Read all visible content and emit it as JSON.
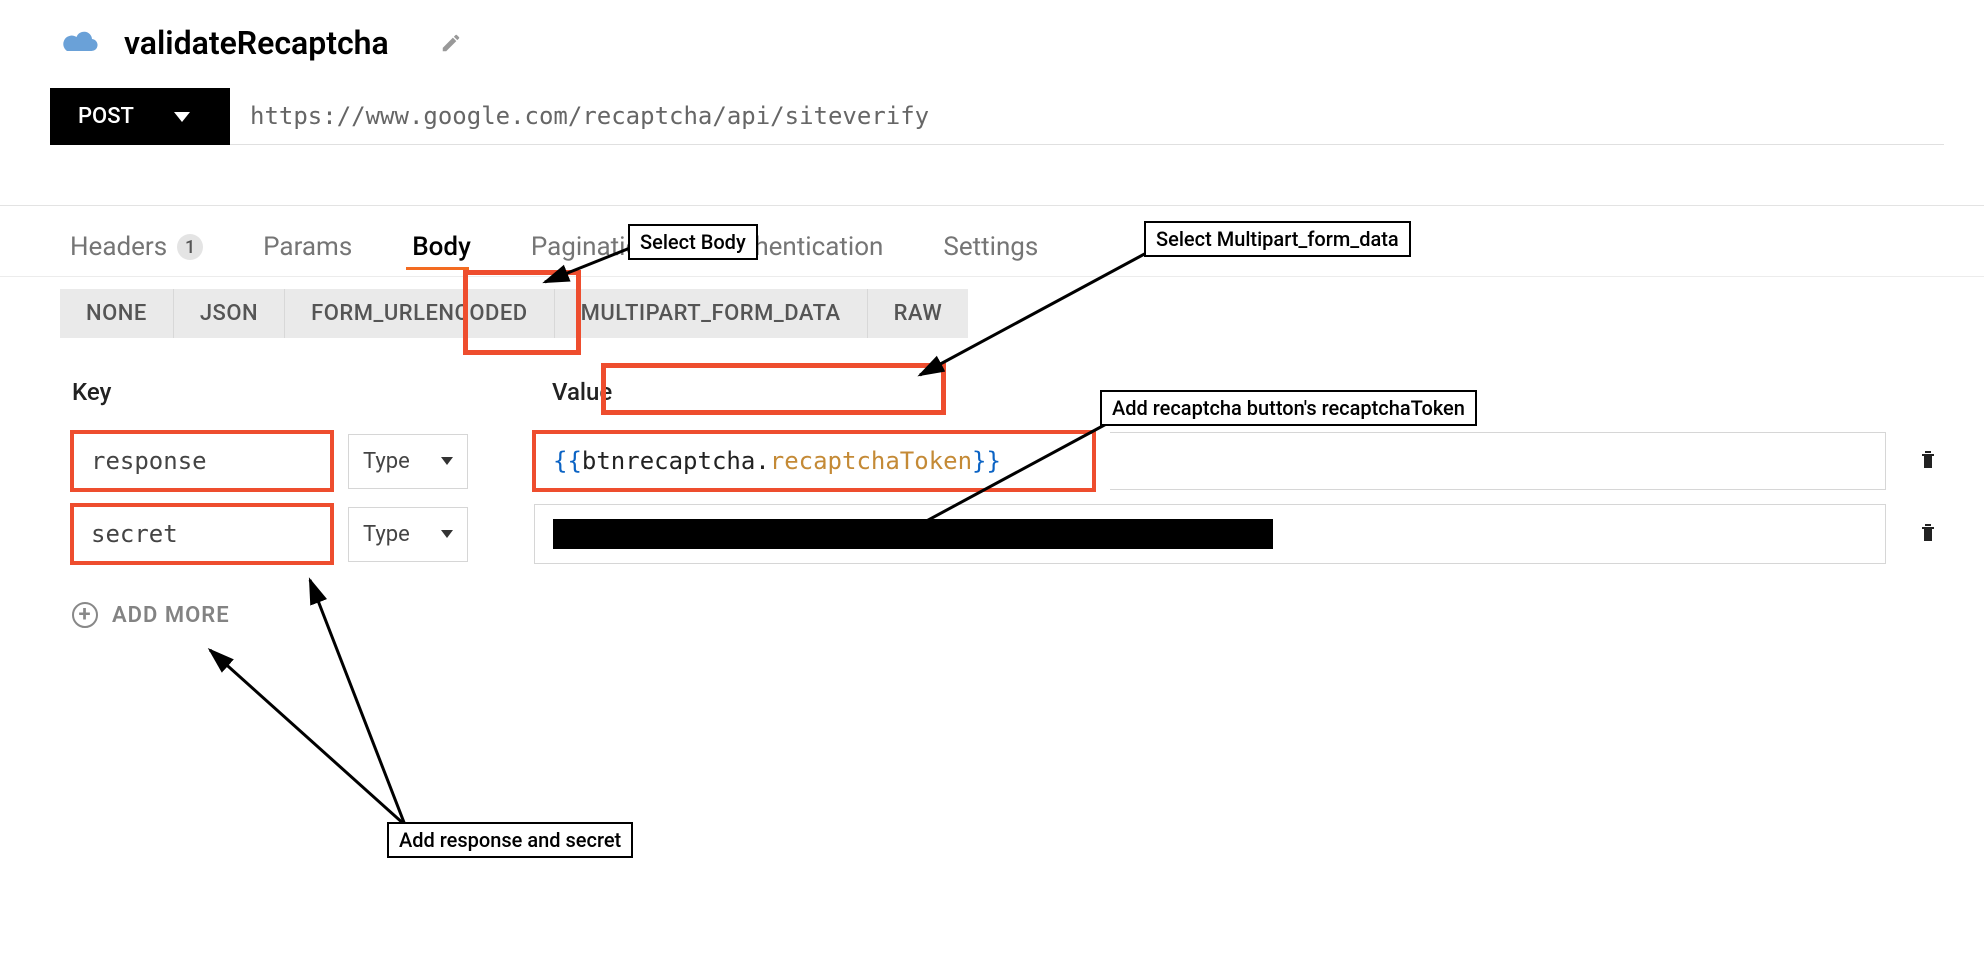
{
  "title": "validateRecaptcha",
  "method": "POST",
  "url": "https://www.google.com/recaptcha/api/siteverify",
  "tabs": [
    {
      "label": "Headers",
      "badge": "1"
    },
    {
      "label": "Params"
    },
    {
      "label": "Body",
      "active": true
    },
    {
      "label": "Pagination"
    },
    {
      "label": "Authentication"
    },
    {
      "label": "Settings"
    }
  ],
  "body_types": [
    "NONE",
    "JSON",
    "FORM_URLENCODED",
    "MULTIPART_FORM_DATA",
    "RAW"
  ],
  "kv_header_key": "Key",
  "kv_header_value": "Value",
  "type_label": "Type",
  "rows": [
    {
      "key": "response",
      "value_obj": "btnrecaptcha",
      "value_prop": "recaptchaToken"
    },
    {
      "key": "secret",
      "redacted": true
    }
  ],
  "add_more": "ADD MORE",
  "annotations": {
    "select_body": "Select Body",
    "select_multipart": "Select Multipart_form_data",
    "add_token": "Add recaptcha button's recaptchaToken",
    "add_keys": "Add response and secret"
  }
}
